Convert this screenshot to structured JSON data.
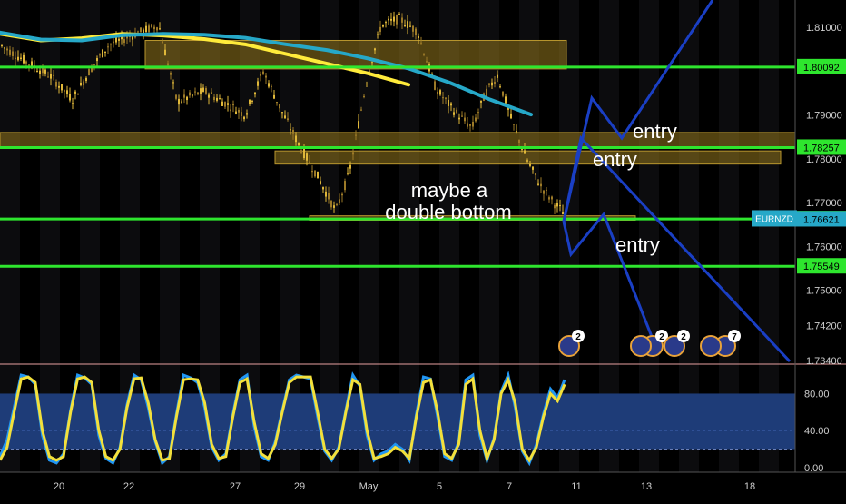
{
  "chart_data": {
    "type": "candlestick",
    "symbol": "EURNZD",
    "price_axis": {
      "ticks": [
        "1.81000",
        "1.79000",
        "1.78000",
        "1.77000",
        "1.76000",
        "1.75000",
        "1.74200",
        "1.73400"
      ],
      "ylim": [
        1.734,
        1.816
      ]
    },
    "price_badges": [
      {
        "label": "1.80092",
        "value": 1.80092,
        "kind": "level"
      },
      {
        "label": "1.78257",
        "value": 1.78257,
        "kind": "level"
      },
      {
        "label": "1.76628",
        "value": 1.76628,
        "kind": "level"
      },
      {
        "label": "1.76621",
        "value": 1.76621,
        "kind": "last"
      },
      {
        "label": "1.75549",
        "value": 1.75549,
        "kind": "level"
      }
    ],
    "date_axis": {
      "labels": [
        "20",
        "22",
        "27",
        "29",
        "May",
        "5",
        "7",
        "11",
        "13",
        "18"
      ]
    },
    "horizontal_levels": [
      1.80092,
      1.78257,
      1.76628,
      1.75549
    ],
    "zones": [
      {
        "from": 1.8005,
        "to": 1.807
      },
      {
        "from": 1.7825,
        "to": 1.786
      },
      {
        "from": 1.7788,
        "to": 1.7818
      },
      {
        "from": 1.766,
        "to": 1.767
      }
    ],
    "moving_averages": [
      {
        "color": "#ffeb3b",
        "values": [
          1.8085,
          1.807,
          1.8075,
          1.8085,
          1.8081,
          1.8073,
          1.8061,
          1.8039,
          1.8017,
          1.7995,
          1.7969
        ]
      },
      {
        "color": "#26a8c8",
        "values": [
          1.8088,
          1.8072,
          1.807,
          1.8082,
          1.8085,
          1.8083,
          1.8076,
          1.8061,
          1.8048,
          1.8029,
          1.8006,
          1.7974,
          1.7935,
          1.7901
        ]
      }
    ],
    "annotations": [
      "entry",
      "entry",
      "entry",
      "maybe a",
      "double bottom"
    ],
    "event_markers": [
      {
        "count": "2"
      },
      {
        "count": "2"
      },
      {
        "count": "2"
      },
      {
        "count": "7"
      }
    ],
    "oscillator": {
      "ticks": [
        "80.00",
        "40.00",
        "0.00"
      ],
      "ylim": [
        -5,
        105
      ],
      "band": [
        20,
        80
      ],
      "yellow": [
        8,
        22,
        60,
        96,
        98,
        92,
        40,
        12,
        8,
        12,
        60,
        96,
        98,
        92,
        40,
        12,
        8,
        20,
        65,
        96,
        97,
        70,
        30,
        8,
        10,
        55,
        95,
        96,
        95,
        70,
        25,
        10,
        12,
        55,
        92,
        96,
        50,
        15,
        10,
        25,
        60,
        92,
        98,
        98,
        98,
        60,
        20,
        10,
        20,
        60,
        95,
        90,
        40,
        10,
        12,
        15,
        22,
        18,
        10,
        55,
        92,
        95,
        60,
        15,
        10,
        25,
        90,
        96,
        40,
        10,
        30,
        80,
        95,
        70,
        20,
        8,
        22,
        55,
        80,
        72,
        90
      ],
      "blue": [
        12,
        30,
        65,
        100,
        98,
        90,
        35,
        8,
        5,
        15,
        62,
        100,
        97,
        90,
        35,
        10,
        5,
        22,
        68,
        100,
        95,
        65,
        28,
        5,
        12,
        58,
        100,
        97,
        92,
        65,
        22,
        8,
        15,
        58,
        95,
        100,
        45,
        12,
        8,
        28,
        62,
        95,
        100,
        98,
        96,
        55,
        18,
        8,
        22,
        62,
        100,
        88,
        35,
        8,
        15,
        18,
        25,
        20,
        8,
        58,
        98,
        96,
        55,
        12,
        8,
        28,
        95,
        100,
        35,
        8,
        32,
        82,
        100,
        65,
        18,
        5,
        25,
        58,
        85,
        75,
        95
      ]
    }
  }
}
